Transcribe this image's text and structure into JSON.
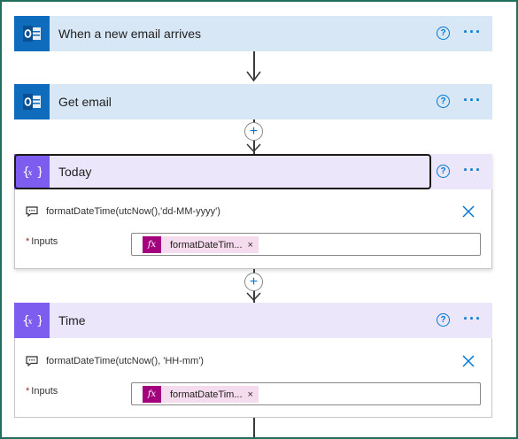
{
  "steps": [
    {
      "id": "trigger",
      "title": "When a new email arrives",
      "icon": "outlook-icon",
      "help": "?",
      "more": "···"
    },
    {
      "id": "get-email",
      "title": "Get email",
      "icon": "outlook-icon",
      "help": "?",
      "more": "···"
    },
    {
      "id": "today",
      "title": "Today",
      "icon": "variable-icon",
      "help": "?",
      "more": "···",
      "comment": "formatDateTime(utcNow(),'dd-MM-yyyy')",
      "inputs_label": "Inputs",
      "required_mark": "*",
      "token": {
        "fx": "fx",
        "label": "formatDateTim...",
        "remove": "×"
      }
    },
    {
      "id": "time",
      "title": "Time",
      "icon": "variable-icon",
      "help": "?",
      "more": "···",
      "comment": "formatDateTime(utcNow(), 'HH-mm')",
      "inputs_label": "Inputs",
      "required_mark": "*",
      "token": {
        "fx": "fx",
        "label": "formatDateTim...",
        "remove": "×"
      }
    }
  ],
  "insert_step": "+",
  "colors": {
    "outlook_blue": "#0f6cbd",
    "email_header": "#d8e7f6",
    "variable_purple": "#7d5cf0",
    "variable_header": "#ece6fb",
    "accent": "#0078d4",
    "token_fx": "#a3007e",
    "token_bg": "#f4dbee",
    "required": "#a4262c"
  }
}
